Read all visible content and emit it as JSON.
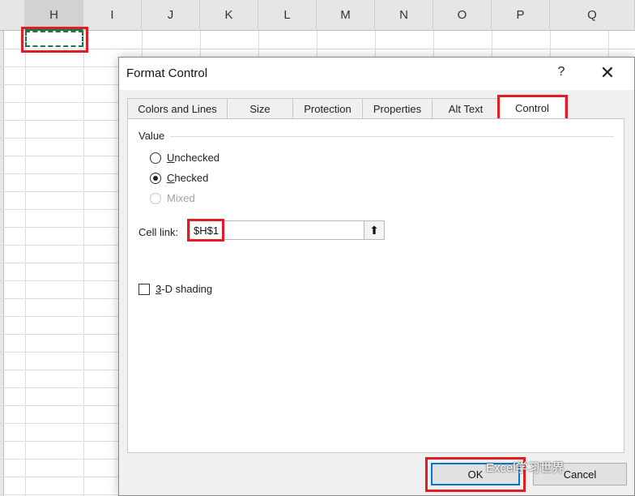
{
  "spreadsheet": {
    "columns": [
      "H",
      "I",
      "J",
      "K",
      "L",
      "M",
      "N",
      "O",
      "P",
      "Q"
    ],
    "selected_column": "H",
    "partial_left_label": ""
  },
  "dialog": {
    "title": "Format Control",
    "help_label": "?",
    "close_label": "✕",
    "tabs": [
      {
        "label": "Colors and Lines",
        "active": false
      },
      {
        "label": "Size",
        "active": false
      },
      {
        "label": "Protection",
        "active": false
      },
      {
        "label": "Properties",
        "active": false
      },
      {
        "label": "Alt Text",
        "active": false
      },
      {
        "label": "Control",
        "active": true
      }
    ],
    "value_group": {
      "label": "Value",
      "options": [
        {
          "accel": "U",
          "rest": "nchecked",
          "selected": false,
          "enabled": true
        },
        {
          "accel": "C",
          "rest": "hecked",
          "selected": true,
          "enabled": true
        },
        {
          "accel": "",
          "rest": "Mixed",
          "selected": false,
          "enabled": false
        }
      ]
    },
    "cell_link": {
      "label": "Cell link:",
      "value": "$H$1",
      "ref_button_icon": "collapse-dialog-icon"
    },
    "shading": {
      "accel": "3",
      "rest": "-D shading",
      "checked": false
    },
    "buttons": {
      "ok": "OK",
      "cancel": "Cancel"
    }
  },
  "watermark": "Excel学习世界",
  "colors": {
    "highlight_red": "#e01c24",
    "excel_green": "#217346",
    "default_button_blue": "#0078d7"
  }
}
